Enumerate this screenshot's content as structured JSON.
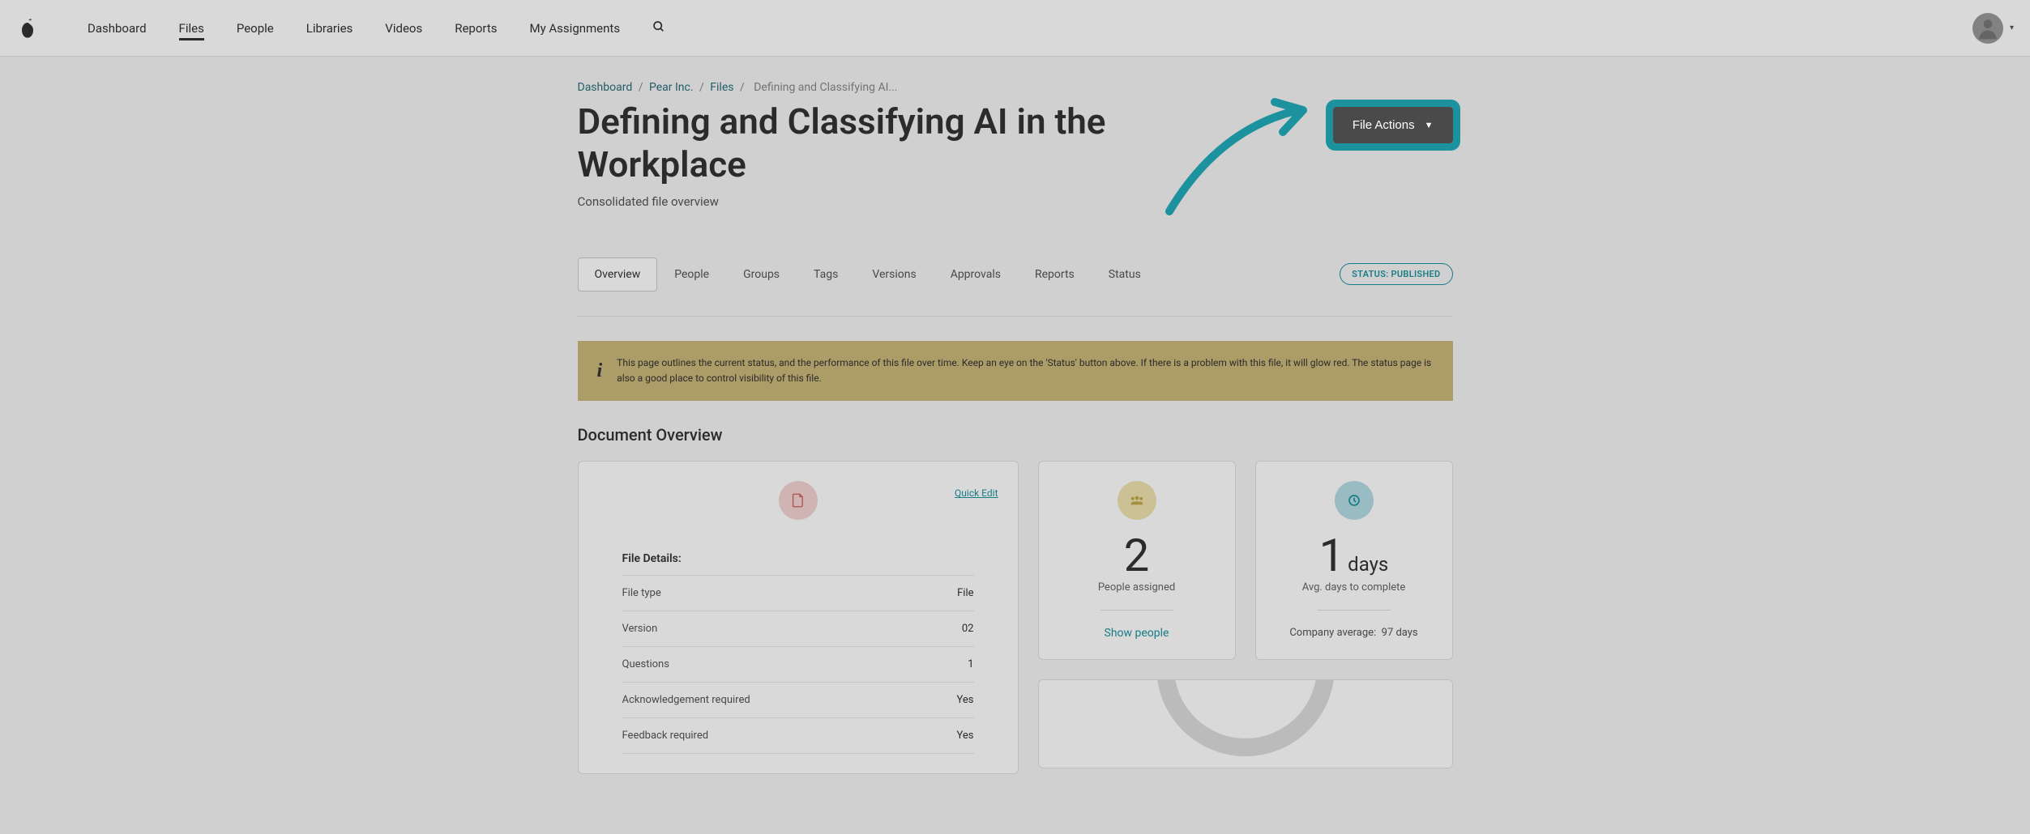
{
  "nav": {
    "items": [
      {
        "label": "Dashboard",
        "active": false
      },
      {
        "label": "Files",
        "active": true
      },
      {
        "label": "People",
        "active": false
      },
      {
        "label": "Libraries",
        "active": false
      },
      {
        "label": "Videos",
        "active": false
      },
      {
        "label": "Reports",
        "active": false
      },
      {
        "label": "My Assignments",
        "active": false
      }
    ]
  },
  "breadcrumb": {
    "items": [
      {
        "label": "Dashboard",
        "link": true
      },
      {
        "label": "Pear Inc.",
        "link": true
      },
      {
        "label": "Files",
        "link": true
      },
      {
        "label": "Defining and Classifying AI...",
        "link": false
      }
    ]
  },
  "header": {
    "title": "Defining and Classifying AI in the Workplace",
    "subtitle": "Consolidated file overview",
    "file_actions_label": "File Actions"
  },
  "tabs": {
    "items": [
      {
        "label": "Overview",
        "active": true
      },
      {
        "label": "People",
        "active": false
      },
      {
        "label": "Groups",
        "active": false
      },
      {
        "label": "Tags",
        "active": false
      },
      {
        "label": "Versions",
        "active": false
      },
      {
        "label": "Approvals",
        "active": false
      },
      {
        "label": "Reports",
        "active": false
      },
      {
        "label": "Status",
        "active": false
      }
    ],
    "status_badge": "STATUS: PUBLISHED"
  },
  "info_banner": {
    "text": "This page outlines the current status, and the performance of this file over time. Keep an eye on the 'Status' button above. If there is a problem with this file, it will glow red. The status page is also a good place to control visibility of this file."
  },
  "overview": {
    "section_title": "Document Overview",
    "quick_edit": "Quick Edit",
    "file_details_title": "File Details:",
    "details": [
      {
        "label": "File type",
        "value": "File"
      },
      {
        "label": "Version",
        "value": "02"
      },
      {
        "label": "Questions",
        "value": "1"
      },
      {
        "label": "Acknowledgement required",
        "value": "Yes"
      },
      {
        "label": "Feedback required",
        "value": "Yes"
      }
    ]
  },
  "metrics": {
    "people": {
      "number": "2",
      "label": "People assigned",
      "action": "Show people"
    },
    "days": {
      "number": "1",
      "suffix": "days",
      "label": "Avg. days to complete",
      "footer_prefix": "Company average:",
      "footer_value": "97 days"
    }
  }
}
